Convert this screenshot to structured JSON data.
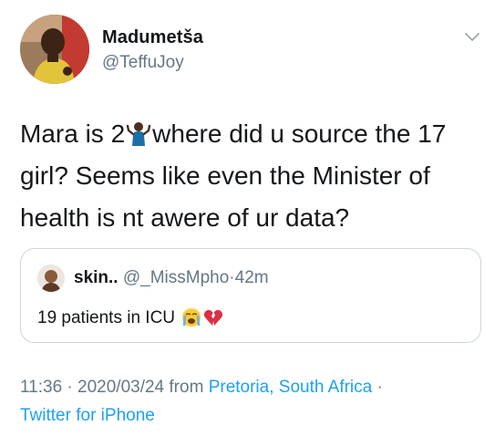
{
  "tweet": {
    "author": {
      "display_name": "Madumetša",
      "handle": "@TeffuJoy",
      "avatar_icon": "profile-photo"
    },
    "menu_icon": "chevron-down-icon",
    "text_part1": "Mara is 2",
    "text_emoji": "person-shrugging-emoji",
    "text_part2": "where did u source the 17 girl? Seems like even the Minister of health is nt awere of ur data?",
    "quoted": {
      "name": "skin..",
      "handle": "@_MissMpho",
      "separator": "·",
      "time": "42m",
      "text": "19 patients in ICU",
      "emojis": [
        "crying-face-emoji",
        "broken-heart-emoji"
      ]
    },
    "meta": {
      "time": "11:36",
      "sep1": "·",
      "date": "2020/03/24",
      "from_label": "from",
      "location": "Pretoria, South Africa",
      "sep2": "·",
      "source": "Twitter for iPhone"
    },
    "colors": {
      "link": "#1da1f2",
      "muted": "#657786",
      "text": "#14171a",
      "border": "#ccd6dd"
    }
  }
}
